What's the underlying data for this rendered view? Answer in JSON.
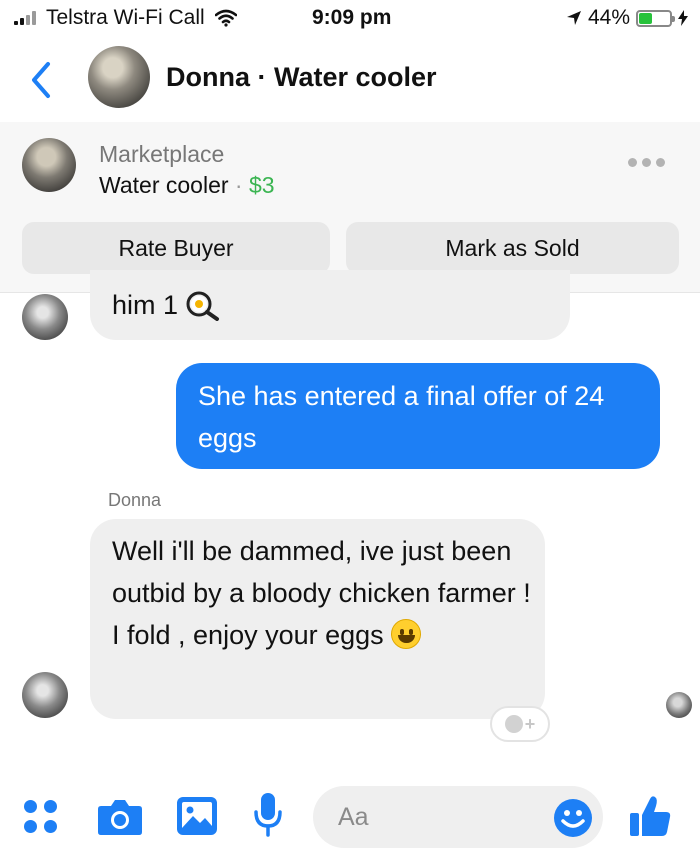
{
  "status_bar": {
    "carrier": "Telstra Wi-Fi Call",
    "time": "9:09 pm",
    "battery": "44%",
    "battery_level": 0.44,
    "icons": [
      "signal-bars-icon",
      "wifi-icon",
      "location-arrow-icon",
      "battery-icon",
      "charging-bolt-icon"
    ]
  },
  "header": {
    "title": "Donna · Water cooler",
    "back_icon": "chevron-left-icon"
  },
  "marketplace": {
    "label": "Marketplace",
    "item": "Water cooler",
    "separator": "·",
    "price": "$3",
    "more_icon": "more-dots-icon",
    "rate_button": "Rate Buyer",
    "sold_button": "Mark as Sold"
  },
  "messages": [
    {
      "from": "Donna",
      "text": "him 1",
      "emoji": "frying-pan-egg-icon"
    },
    {
      "from": "me",
      "text": "She has entered a final offer of 24 eggs"
    },
    {
      "from": "Donna",
      "text": "Well i'll be dammed, ive just been outbid by a bloody chicken farmer ! I fold , enjoy your eggs",
      "emoji": "grinning-face-icon"
    }
  ],
  "sender_name": "Donna",
  "composer": {
    "placeholder": "Aa",
    "icons": [
      "apps-grid-icon",
      "camera-icon",
      "image-icon",
      "microphone-icon",
      "emoji-icon",
      "thumbs-up-icon"
    ]
  },
  "colors": {
    "accent": "#1d7ff5",
    "price_green": "#3bb552",
    "bubble_gray": "#efefef"
  }
}
